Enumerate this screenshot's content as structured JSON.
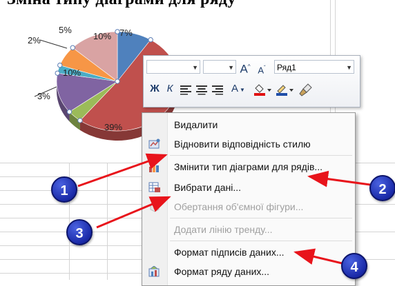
{
  "heading": "Зміна типу діаграми для ряду",
  "chart_data": {
    "type": "pie",
    "labels": [
      "7%",
      "39%",
      "3%",
      "10%",
      "2%",
      "5%",
      "10%"
    ],
    "values": [
      7,
      39,
      3,
      10,
      2,
      5,
      10
    ],
    "colors": [
      "#4f81bd",
      "#c0504d",
      "#9bbb59",
      "#8064a2",
      "#4bacc6",
      "#f79646",
      "#d9a3a3"
    ]
  },
  "mini_toolbar": {
    "font_name": "",
    "font_size": "",
    "grow_font": "A",
    "shrink_font": "A",
    "series_select": "Ряд1",
    "bold": "Ж",
    "italic": "К",
    "font_color": "A"
  },
  "context_menu": {
    "items": [
      {
        "label": "Видалити",
        "disabled": false
      },
      {
        "label": "Відновити відповідність стилю",
        "disabled": false
      },
      {
        "label": "Змінити тип діаграми для рядів...",
        "disabled": false
      },
      {
        "label": "Вибрати дані...",
        "disabled": false
      },
      {
        "label": "Обертання об'ємної фігури...",
        "disabled": true
      },
      {
        "label": "Додати лінію тренду...",
        "disabled": true
      },
      {
        "label": "Формат підписів даних...",
        "disabled": false
      },
      {
        "label": "Формат ряду даних...",
        "disabled": false
      }
    ]
  },
  "callouts": [
    "1",
    "2",
    "3",
    "4"
  ],
  "colors": {
    "arrow": "#e8141b",
    "badge": "#1a2aa8"
  }
}
